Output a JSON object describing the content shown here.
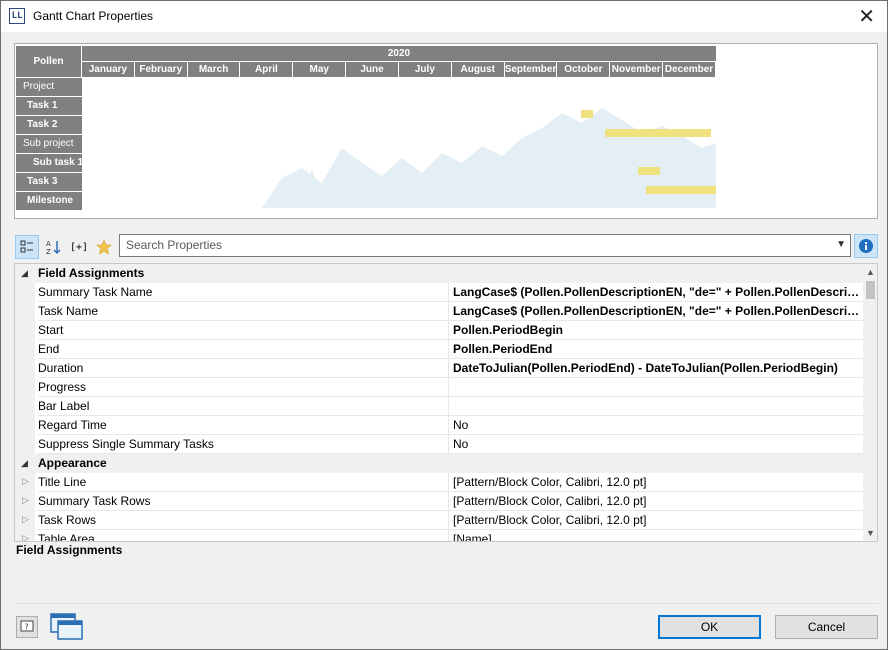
{
  "window": {
    "title": "Gantt Chart Properties",
    "app_icon_text": "LL"
  },
  "gantt": {
    "label_header": "Pollen",
    "year": "2020",
    "months": [
      "January",
      "February",
      "March",
      "April",
      "May",
      "June",
      "July",
      "August",
      "September",
      "October",
      "November",
      "December"
    ],
    "rows": [
      "Project",
      "Task 1",
      "Task 2",
      "Sub project",
      "Sub task 1",
      "Task 3",
      "Milestone"
    ],
    "bar_color": "#efe27e"
  },
  "toolbar": {
    "categorized_icon": "categorized-icon",
    "alphabetical_icon": "sort-az-icon",
    "expand_icon": "expand-collapse-icon",
    "expand_label": "[+]",
    "favorites_icon": "star-icon",
    "search_placeholder": "Search Properties",
    "info_icon": "info-icon"
  },
  "grid": {
    "sections": [
      {
        "title": "Field Assignments",
        "rows": [
          {
            "name": "Summary Task Name",
            "value": "LangCase$ (Pollen.PollenDescriptionEN, \"de=\" + Pollen.PollenDescriptionDE)",
            "bold": true
          },
          {
            "name": "Task Name",
            "value": "LangCase$ (Pollen.PollenDescriptionEN, \"de=\" + Pollen.PollenDescriptionDE)",
            "bold": true
          },
          {
            "name": "Start",
            "value": "Pollen.PeriodBegin",
            "bold": true
          },
          {
            "name": "End",
            "value": "Pollen.PeriodEnd",
            "bold": true
          },
          {
            "name": "Duration",
            "value": "DateToJulian(Pollen.PeriodEnd) - DateToJulian(Pollen.PeriodBegin)",
            "bold": true
          },
          {
            "name": "Progress",
            "value": "",
            "bold": false
          },
          {
            "name": "Bar Label",
            "value": "",
            "bold": false
          },
          {
            "name": "Regard Time",
            "value": "No",
            "bold": false
          },
          {
            "name": "Suppress Single Summary Tasks",
            "value": "No",
            "bold": false
          }
        ]
      },
      {
        "title": "Appearance",
        "rows": [
          {
            "name": "Title Line",
            "value": "[Pattern/Block Color, Calibri, 12.0 pt]",
            "bold": false
          },
          {
            "name": "Summary Task Rows",
            "value": "[Pattern/Block Color, Calibri, 12.0 pt]",
            "bold": false
          },
          {
            "name": "Task Rows",
            "value": "[Pattern/Block Color, Calibri, 12.0 pt]",
            "bold": false
          },
          {
            "name": "Table Area",
            "value": "[Name]",
            "bold": false
          }
        ]
      }
    ]
  },
  "description": {
    "title": "Field Assignments"
  },
  "buttons": {
    "ok": "OK",
    "cancel": "Cancel",
    "help_icon": "help-icon",
    "window_icon": "window-switch-icon"
  }
}
